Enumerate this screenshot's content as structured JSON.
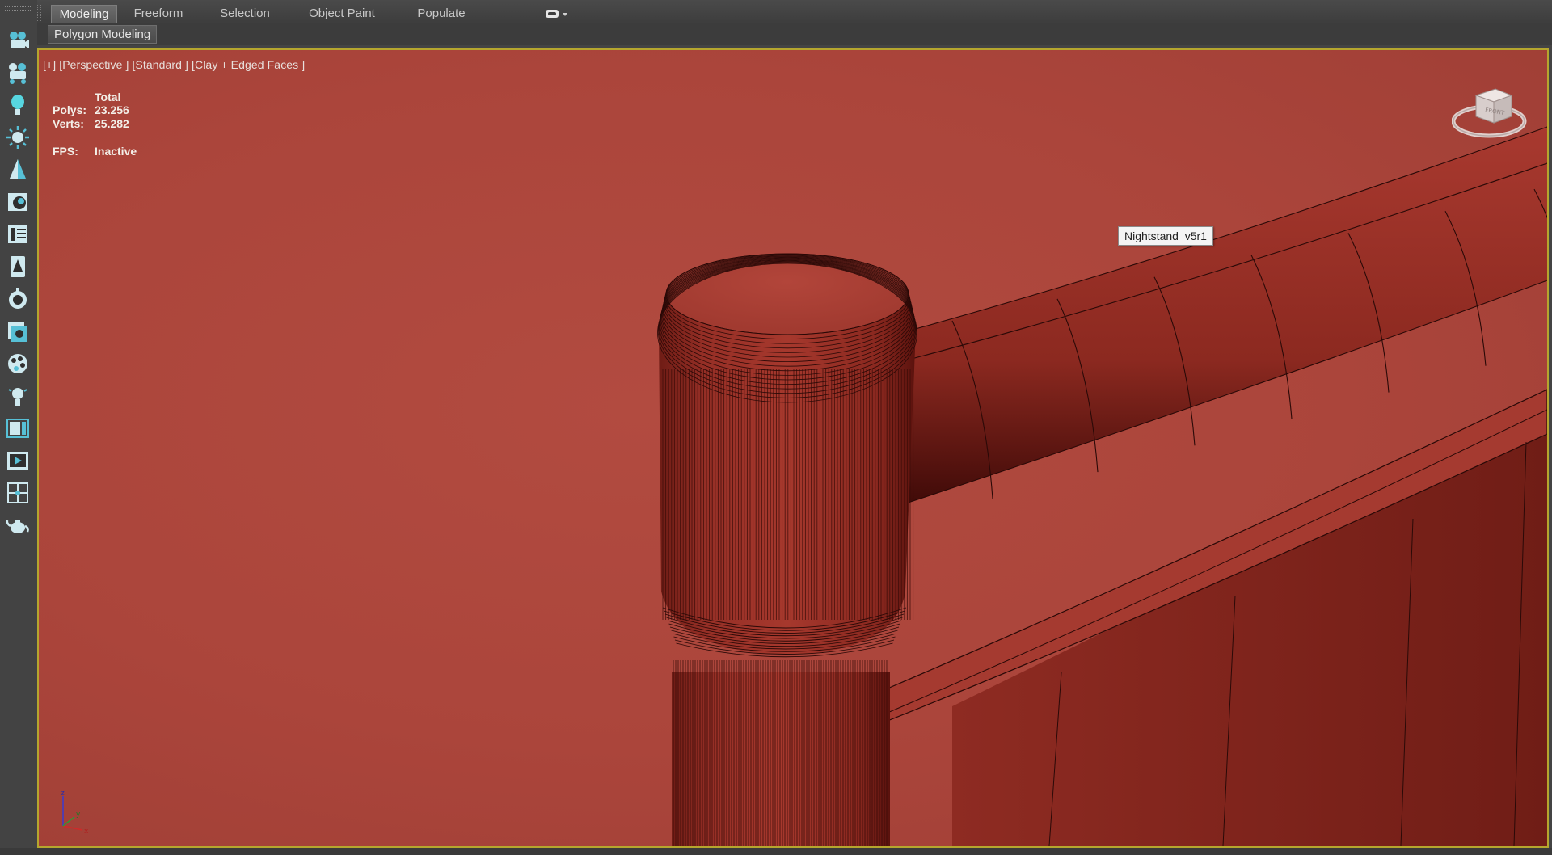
{
  "ribbon": {
    "tabs": [
      {
        "label": "Modeling",
        "active": true
      },
      {
        "label": "Freeform",
        "active": false
      },
      {
        "label": "Selection",
        "active": false
      },
      {
        "label": "Object Paint",
        "active": false
      },
      {
        "label": "Populate",
        "active": false
      }
    ],
    "dropdown_icon": "toggle-dropdown-icon",
    "panel_label": "Polygon Modeling"
  },
  "left_toolbar": {
    "icons": [
      "camera-icon",
      "camera-rig-icon",
      "light-bulb-icon",
      "sun-icon",
      "tree-icon",
      "material-editor-icon",
      "scene-explorer-icon",
      "foliage-icon",
      "render-setup-icon",
      "render-frame-icon",
      "palette-icon",
      "omni-light-icon",
      "viewport-layout-icon",
      "active-shade-icon",
      "grid-snap-icon",
      "teapot-icon"
    ]
  },
  "viewport": {
    "label": "[+] [Perspective ] [Standard ] [Clay + Edged Faces ]",
    "stats": {
      "header": "Total",
      "polys_label": "Polys:",
      "polys_value": "23.256",
      "verts_label": "Verts:",
      "verts_value": "25.282",
      "fps_label": "FPS:",
      "fps_value": "Inactive"
    },
    "tooltip": "Nightstand_v5r1",
    "viewcube_face": "FRONT",
    "axis_labels": {
      "x": "x",
      "y": "y",
      "z": "z"
    },
    "colors": {
      "background": "#ab453b",
      "object_fill": "#8e2c24",
      "wire": "#2a0907",
      "active_border": "#b5a62e"
    }
  }
}
